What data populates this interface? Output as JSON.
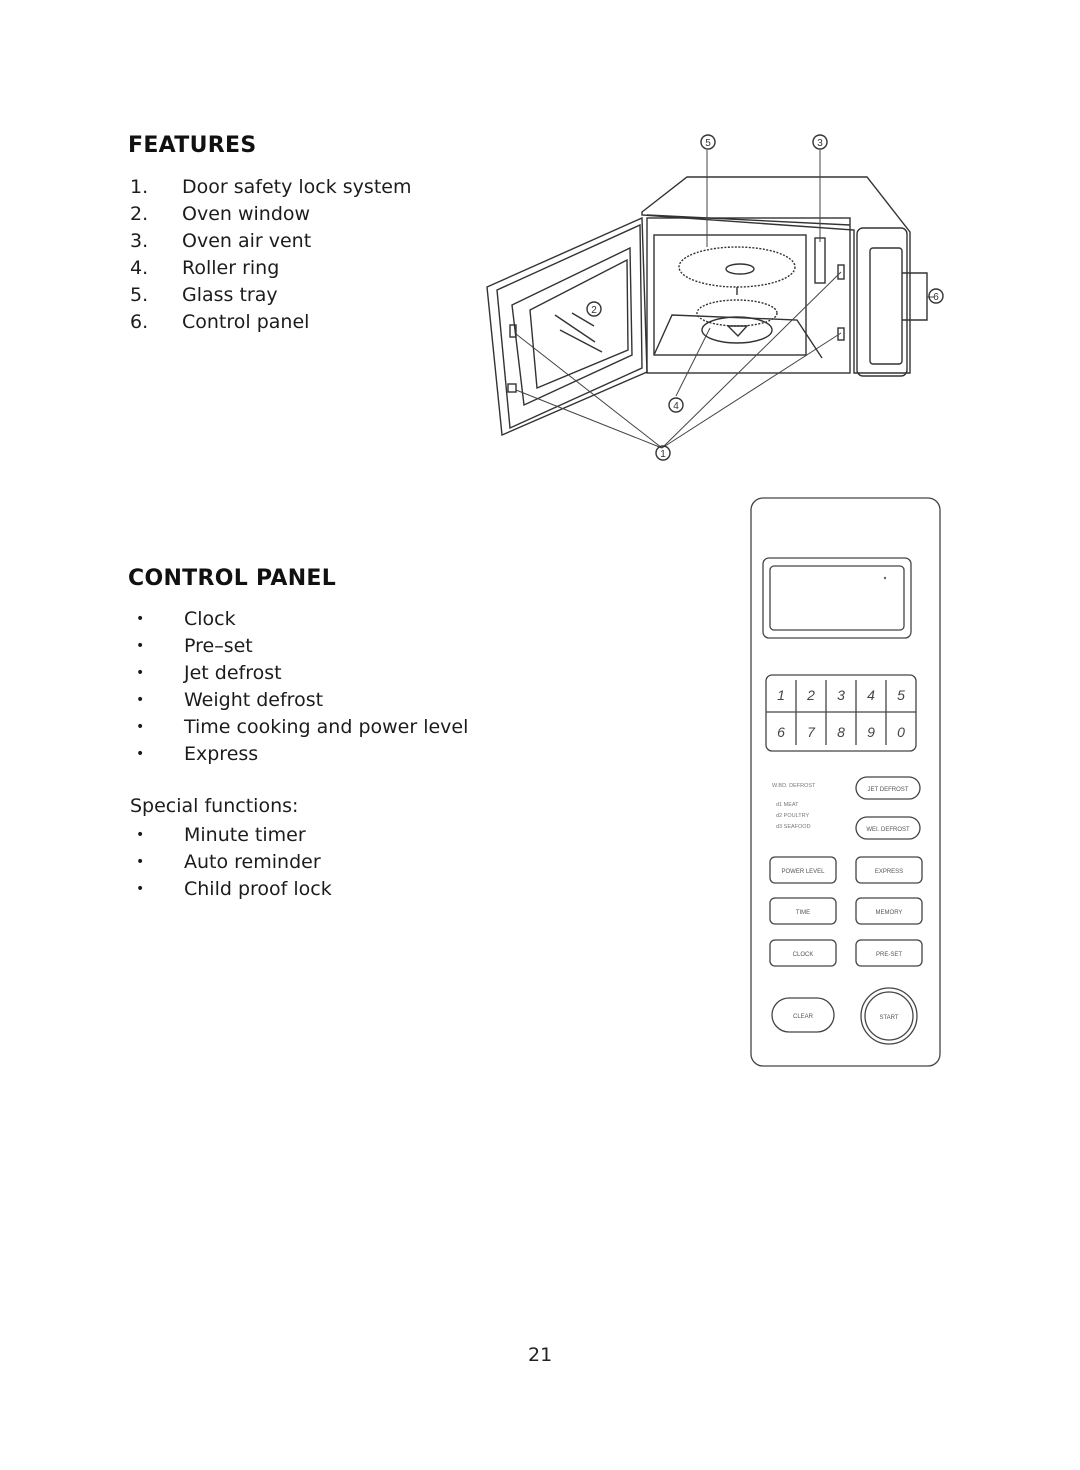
{
  "features": {
    "heading": "FEATURES",
    "items": [
      {
        "num": "1.",
        "label": "Door safety lock system"
      },
      {
        "num": "2.",
        "label": "Oven window"
      },
      {
        "num": "3.",
        "label": "Oven air vent"
      },
      {
        "num": "4.",
        "label": "Roller ring"
      },
      {
        "num": "5.",
        "label": "Glass tray"
      },
      {
        "num": "6.",
        "label": "Control panel"
      }
    ],
    "diagram_callouts": [
      "1",
      "2",
      "3",
      "4",
      "5",
      "6"
    ]
  },
  "control_panel": {
    "heading": "CONTROL PANEL",
    "bullet": "•",
    "items": [
      "Clock",
      "Pre–set",
      "Jet defrost",
      "Weight defrost",
      "Time cooking and power level",
      "Express"
    ],
    "special_label": "Special functions:",
    "special_items": [
      "Minute timer",
      "Auto reminder",
      "Child proof lock"
    ],
    "diagram": {
      "keypad": [
        "1",
        "2",
        "3",
        "4",
        "5",
        "6",
        "7",
        "8",
        "9",
        "0"
      ],
      "weight_defrost_title": "W.BD. DEFROST",
      "weight_defrost_options": [
        "d1 MEAT",
        "d2 POULTRY",
        "d3 SEAFOOD"
      ],
      "buttons": [
        "JET DEFROST",
        "WEI. DEFROST",
        "POWER LEVEL",
        "EXPRESS",
        "TIME",
        "MEMORY",
        "CLOCK",
        "PRE-SET",
        "CLEAR",
        "START"
      ]
    }
  },
  "page_number": "21"
}
